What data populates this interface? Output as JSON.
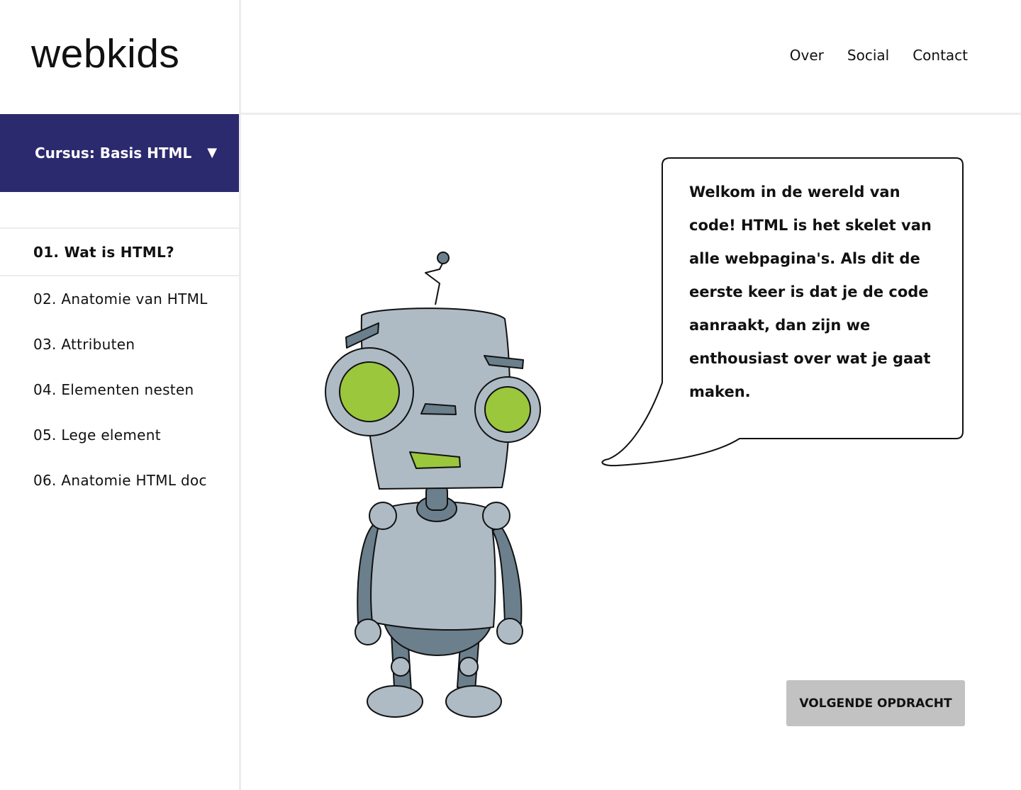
{
  "brand": {
    "logo_text": "webkids"
  },
  "nav": {
    "items": [
      "Over",
      "Social",
      "Contact"
    ]
  },
  "course": {
    "label": "Cursus: Basis HTML",
    "arrow": "▼"
  },
  "lessons": [
    {
      "label": "01.  Wat is HTML?",
      "active": true
    },
    {
      "label": "02. Anatomie van HTML",
      "active": false
    },
    {
      "label": "03. Attributen",
      "active": false
    },
    {
      "label": "04. Elementen nesten",
      "active": false
    },
    {
      "label": "05. Lege element",
      "active": false
    },
    {
      "label": "06. Anatomie HTML doc",
      "active": false
    }
  ],
  "speech": {
    "text": "Welkom in de wereld van code! HTML is het skelet van alle webpagina's. Als dit de eerste keer is dat je de code aanraakt, dan zijn we enthousiast over wat je gaat maken."
  },
  "actions": {
    "next_label": "VOLGENDE OPDRACHT"
  },
  "colors": {
    "sidebar_accent": "#2c2a6e",
    "robot_body": "#aebbc4",
    "robot_dark": "#6b7f8c",
    "robot_eye": "#9bc73d",
    "button_bg": "#c2c2c2"
  },
  "icons": {
    "course_dropdown": "caret-down-icon",
    "mascot": "robot-illustration"
  }
}
